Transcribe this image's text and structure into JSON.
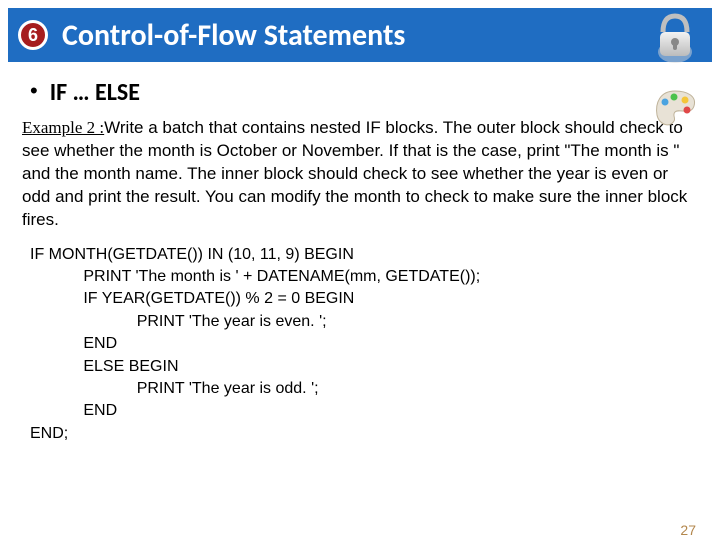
{
  "header": {
    "chapter_number": "6",
    "title": "Control-of-Flow Statements"
  },
  "subhead": {
    "bullet": "•",
    "text": "IF … ELSE"
  },
  "example": {
    "label": "Example 2 :",
    "body": "Write a batch that contains nested IF blocks. The outer block should check to see whether the month is October or November. If that is the case, print \"The month is \" and the month name.\nThe inner block should check to see whether the year is even or odd and print the result. You can modify the month to check to make sure the inner block fires."
  },
  "code": "IF MONTH(GETDATE()) IN (10, 11, 9) BEGIN\n            PRINT 'The month is ' + DATENAME(mm, GETDATE());\n            IF YEAR(GETDATE()) % 2 = 0 BEGIN\n                        PRINT 'The year is even. ';\n            END\n            ELSE BEGIN\n                        PRINT 'The year is odd. ';\n            END\nEND;",
  "page_number": "27"
}
